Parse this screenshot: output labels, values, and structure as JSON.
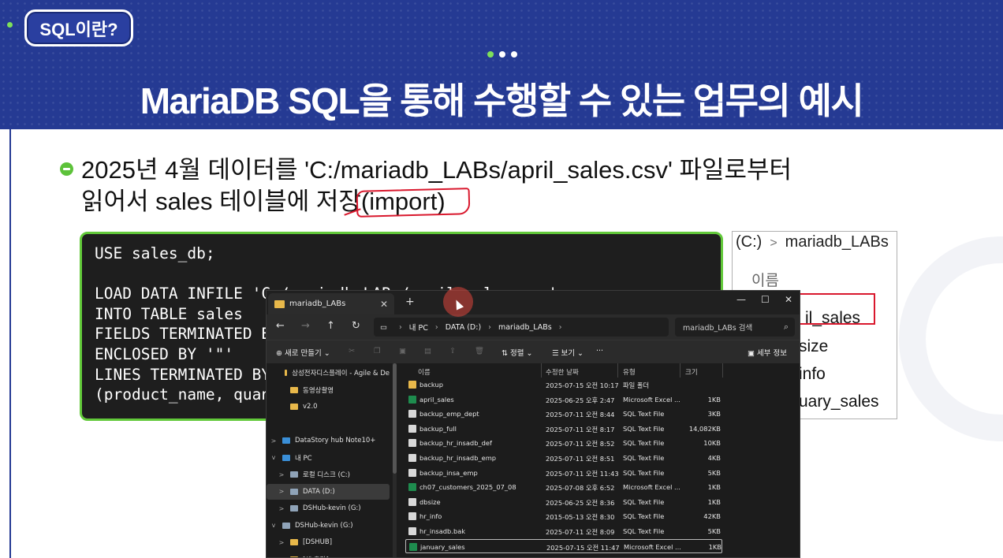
{
  "badge": "SQL이란?",
  "title": "MariaDB SQL을 통해 수행할 수 있는 업무의 예시",
  "desc_line1": "2025년 4월 데이터를 'C:/mariadb_LABs/april_sales.csv' 파일로부터",
  "desc_line2_a": "읽어서 sales 테이블에 저장",
  "desc_line2_b": "(import)",
  "code": "USE sales_db;\n\nLOAD DATA INFILE 'C:/mariadb_LABs/april_sales.csv'\nINTO TABLE sales\nFIELDS TERMINATED BY ','\nENCLOSED BY '\"'\nLINES TERMINATED BY '\\n'\n(product_name, quantity, price, sales_date);",
  "crop": {
    "path_drive": "(C:)",
    "path_sep": ">",
    "path_folder": "mariadb_LABs",
    "header": "이름",
    "rows": [
      "il_sales",
      "size",
      "info",
      "uary_sales"
    ]
  },
  "explorer": {
    "tab_label": "mariadb_LABs",
    "tab_close": "✕",
    "new_tab": "+",
    "minimize": "—",
    "maximize": "☐",
    "close": "✕",
    "address": [
      "내 PC",
      "DATA (D:)",
      "mariadb_LABs"
    ],
    "search_placeholder": "mariadb_LABs 검색",
    "commands": {
      "new": "새로 만들기",
      "sort": "정렬",
      "view": "보기",
      "more": "···",
      "details": "세부 정보"
    },
    "sidebar": [
      {
        "label": "삼성전자디스플레이 - Agile & De",
        "indent": 1,
        "type": "folder"
      },
      {
        "label": "동영상촬영",
        "indent": 1,
        "type": "folder"
      },
      {
        "label": "v2.0",
        "indent": 1,
        "type": "folder"
      },
      {
        "label": "",
        "indent": 1,
        "type": "gap"
      },
      {
        "label": "DataStory hub Note10+",
        "indent": 0,
        "type": "device",
        "chevron": ">"
      },
      {
        "label": "내 PC",
        "indent": 0,
        "type": "pc",
        "chevron": "v"
      },
      {
        "label": "로컬 디스크 (C:)",
        "indent": 1,
        "type": "drive",
        "chevron": ">"
      },
      {
        "label": "DATA (D:)",
        "indent": 1,
        "type": "drive",
        "chevron": ">",
        "selected": true
      },
      {
        "label": "DSHub-kevin (G:)",
        "indent": 1,
        "type": "drive",
        "chevron": ">"
      },
      {
        "label": "DSHub-kevin (G:)",
        "indent": 0,
        "type": "drive",
        "chevron": "v"
      },
      {
        "label": "[DSHUB]",
        "indent": 1,
        "type": "folder",
        "chevron": ">"
      },
      {
        "label": "[책 출간]",
        "indent": 1,
        "type": "folder",
        "chevron": ">"
      }
    ],
    "columns": [
      "이름",
      "수정한 날짜",
      "유형",
      "크기"
    ],
    "files": [
      {
        "name": "backup",
        "date": "2025-07-15 오전 10:17",
        "type": "파일 폴더",
        "size": "",
        "kind": "folder"
      },
      {
        "name": "april_sales",
        "date": "2025-06-25 오후 2:47",
        "type": "Microsoft Excel ...",
        "size": "1KB",
        "kind": "excel"
      },
      {
        "name": "backup_emp_dept",
        "date": "2025-07-11 오전 8:44",
        "type": "SQL Text File",
        "size": "3KB",
        "kind": "sql"
      },
      {
        "name": "backup_full",
        "date": "2025-07-11 오전 8:17",
        "type": "SQL Text File",
        "size": "14,082KB",
        "kind": "sql"
      },
      {
        "name": "backup_hr_insadb_def",
        "date": "2025-07-11 오전 8:52",
        "type": "SQL Text File",
        "size": "10KB",
        "kind": "sql"
      },
      {
        "name": "backup_hr_insadb_emp",
        "date": "2025-07-11 오전 8:51",
        "type": "SQL Text File",
        "size": "4KB",
        "kind": "sql"
      },
      {
        "name": "backup_insa_emp",
        "date": "2025-07-11 오전 11:43",
        "type": "SQL Text File",
        "size": "5KB",
        "kind": "sql"
      },
      {
        "name": "ch07_customers_2025_07_08",
        "date": "2025-07-08 오후 6:52",
        "type": "Microsoft Excel ...",
        "size": "1KB",
        "kind": "excel"
      },
      {
        "name": "dbsize",
        "date": "2025-06-25 오전 8:36",
        "type": "SQL Text File",
        "size": "1KB",
        "kind": "sql"
      },
      {
        "name": "hr_info",
        "date": "2015-05-13 오전 8:30",
        "type": "SQL Text File",
        "size": "42KB",
        "kind": "sql"
      },
      {
        "name": "hr_insadb.bak",
        "date": "2025-07-11 오전 8:09",
        "type": "SQL Text File",
        "size": "5KB",
        "kind": "sql"
      },
      {
        "name": "january_sales",
        "date": "2025-07-15 오전 11:47",
        "type": "Microsoft Excel ...",
        "size": "1KB",
        "kind": "excel",
        "selected": true
      }
    ]
  },
  "colors": {
    "band": "#253a93",
    "accent_green": "#62c93a",
    "annotation_red": "#d9182d"
  }
}
